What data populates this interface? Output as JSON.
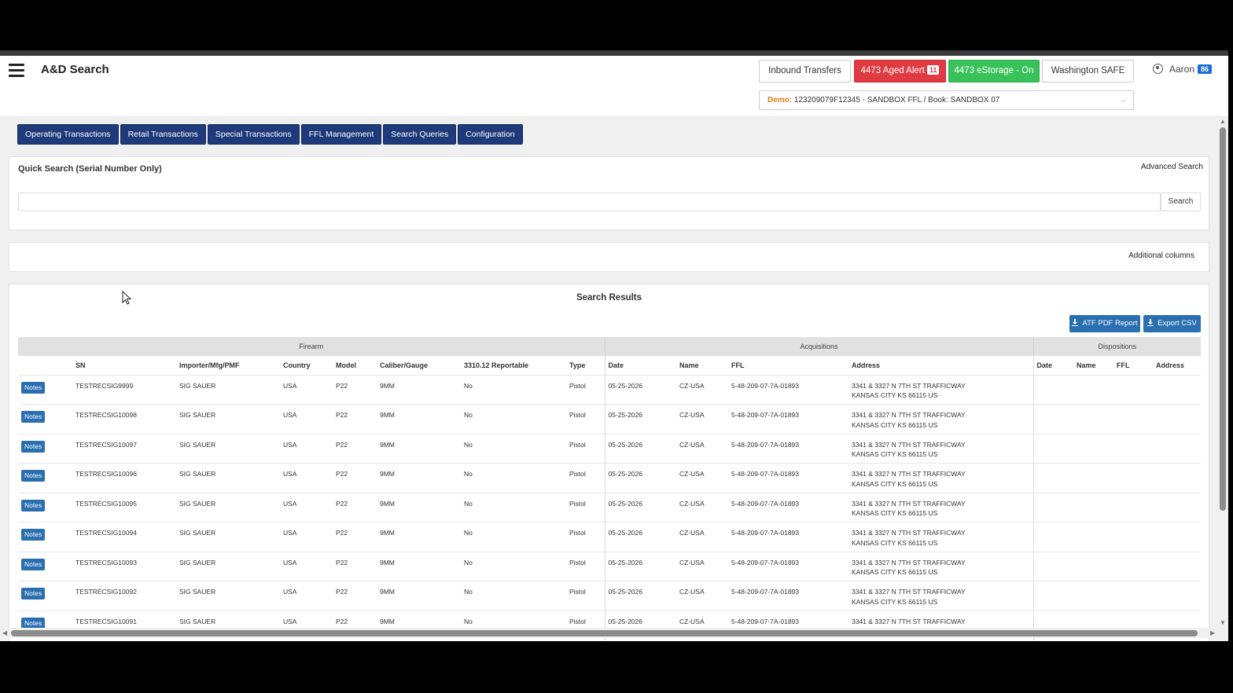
{
  "header": {
    "title": "A&D Search",
    "buttons": {
      "inbound": "Inbound Transfers",
      "aged_alert": "4473 Aged Alert",
      "aged_alert_count": "11",
      "estorage": "4473 eStorage - On",
      "washington": "Washington SAFE"
    },
    "user": {
      "name": "Aaron",
      "badge": "86"
    },
    "ffl_selector": {
      "prefix": "Demo:",
      "value": "123209079F12345 - SANDBOX FFL / Book: SANDBOX 07"
    }
  },
  "tabs": [
    "Operating Transactions",
    "Retail Transactions",
    "Special Transactions",
    "FFL Management",
    "Search Queries",
    "Configuration"
  ],
  "quick_search": {
    "title": "Quick Search (Serial Number Only)",
    "advanced": "Advanced Search",
    "search_button": "Search",
    "value": ""
  },
  "additional_columns": "Additional columns",
  "results": {
    "title": "Search Results",
    "atf_button": "ATF PDF Report",
    "csv_button": "Export CSV",
    "groups": {
      "firearm": "Firearm",
      "acquisitions": "Acquisitions",
      "dispositions": "Dispositions"
    },
    "columns": [
      "SN",
      "Importer/Mfg/PMF",
      "Country",
      "Model",
      "Caliber/Gauge",
      "3310.12 Reportable",
      "Type",
      "Date",
      "Name",
      "FFL",
      "Address",
      "Date",
      "Name",
      "FFL",
      "Address"
    ],
    "notes_label": "Notes",
    "rows": [
      {
        "sn": "TESTRECSIG9999",
        "mfg": "SIG SAUER",
        "country": "USA",
        "model": "P22",
        "caliber": "9MM",
        "reportable": "No",
        "type": "Pistol",
        "date": "05-25-2026",
        "name": "CZ-USA",
        "ffl": "5-48-209-07-7A-01893",
        "addr1": "3341 & 3327 N 7TH ST TRAFFICWAY",
        "addr2": "KANSAS CITY KS 66115 US"
      },
      {
        "sn": "TESTRECSIG10098",
        "mfg": "SIG SAUER",
        "country": "USA",
        "model": "P22",
        "caliber": "9MM",
        "reportable": "No",
        "type": "Pistol",
        "date": "05-25-2026",
        "name": "CZ-USA",
        "ffl": "5-48-209-07-7A-01893",
        "addr1": "3341 & 3327 N 7TH ST TRAFFICWAY",
        "addr2": "KANSAS CITY KS 66115 US"
      },
      {
        "sn": "TESTRECSIG10097",
        "mfg": "SIG SAUER",
        "country": "USA",
        "model": "P22",
        "caliber": "9MM",
        "reportable": "No",
        "type": "Pistol",
        "date": "05-25-2026",
        "name": "CZ-USA",
        "ffl": "5-48-209-07-7A-01893",
        "addr1": "3341 & 3327 N 7TH ST TRAFFICWAY",
        "addr2": "KANSAS CITY KS 66115 US"
      },
      {
        "sn": "TESTRECSIG10096",
        "mfg": "SIG SAUER",
        "country": "USA",
        "model": "P22",
        "caliber": "9MM",
        "reportable": "No",
        "type": "Pistol",
        "date": "05-25-2026",
        "name": "CZ-USA",
        "ffl": "5-48-209-07-7A-01893",
        "addr1": "3341 & 3327 N 7TH ST TRAFFICWAY",
        "addr2": "KANSAS CITY KS 66115 US"
      },
      {
        "sn": "TESTRECSIG10095",
        "mfg": "SIG SAUER",
        "country": "USA",
        "model": "P22",
        "caliber": "9MM",
        "reportable": "No",
        "type": "Pistol",
        "date": "05-25-2026",
        "name": "CZ-USA",
        "ffl": "5-48-209-07-7A-01893",
        "addr1": "3341 & 3327 N 7TH ST TRAFFICWAY",
        "addr2": "KANSAS CITY KS 66115 US"
      },
      {
        "sn": "TESTRECSIG10094",
        "mfg": "SIG SAUER",
        "country": "USA",
        "model": "P22",
        "caliber": "9MM",
        "reportable": "No",
        "type": "Pistol",
        "date": "05-25-2026",
        "name": "CZ-USA",
        "ffl": "5-48-209-07-7A-01893",
        "addr1": "3341 & 3327 N 7TH ST TRAFFICWAY",
        "addr2": "KANSAS CITY KS 66115 US"
      },
      {
        "sn": "TESTRECSIG10093",
        "mfg": "SIG SAUER",
        "country": "USA",
        "model": "P22",
        "caliber": "9MM",
        "reportable": "No",
        "type": "Pistol",
        "date": "05-25-2026",
        "name": "CZ-USA",
        "ffl": "5-48-209-07-7A-01893",
        "addr1": "3341 & 3327 N 7TH ST TRAFFICWAY",
        "addr2": "KANSAS CITY KS 66115 US"
      },
      {
        "sn": "TESTRECSIG10092",
        "mfg": "SIG SAUER",
        "country": "USA",
        "model": "P22",
        "caliber": "9MM",
        "reportable": "No",
        "type": "Pistol",
        "date": "05-25-2026",
        "name": "CZ-USA",
        "ffl": "5-48-209-07-7A-01893",
        "addr1": "3341 & 3327 N 7TH ST TRAFFICWAY",
        "addr2": "KANSAS CITY KS 66115 US"
      },
      {
        "sn": "TESTRECSIG10091",
        "mfg": "SIG SAUER",
        "country": "USA",
        "model": "P22",
        "caliber": "9MM",
        "reportable": "No",
        "type": "Pistol",
        "date": "05-25-2026",
        "name": "CZ-USA",
        "ffl": "5-48-209-07-7A-01893",
        "addr1": "3341 & 3327 N 7TH ST TRAFFICWAY",
        "addr2": ""
      }
    ]
  },
  "colors": {
    "tab_bg": "#1f3a7a",
    "alert_red": "#e03a43",
    "estorage_green": "#39c25a",
    "action_blue": "#2a6fb0",
    "user_badge": "#1e6fd9"
  },
  "icons": [
    "menu-icon",
    "user-icon",
    "chevron-down-icon",
    "download-icon"
  ]
}
